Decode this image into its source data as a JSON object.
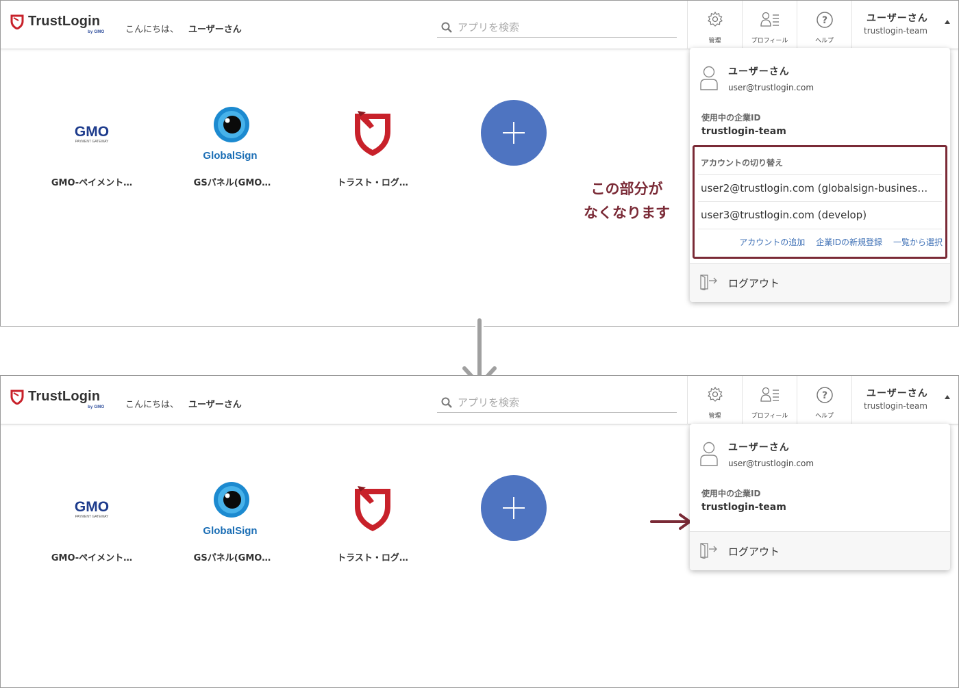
{
  "brand": {
    "name": "TrustLogin",
    "sub": "by GMO",
    "color": "#c8212a"
  },
  "header": {
    "greeting": "こんにちは、",
    "user_greet_name": "ユーザーさん",
    "search_placeholder": "アプリを検索",
    "nav": [
      {
        "icon": "gear-icon",
        "label": "管理"
      },
      {
        "icon": "profile-icon",
        "label": "プロフィール"
      },
      {
        "icon": "help-icon",
        "label": "ヘルプ"
      }
    ],
    "user_name": "ユーザーさん",
    "team": "trustlogin-team"
  },
  "apps": [
    {
      "icon": "gmo-logo",
      "name": "GMO-ペイメント…"
    },
    {
      "icon": "globalsign-logo",
      "name": "GSパネル(GMO…"
    },
    {
      "icon": "trustlogin-logo",
      "name": "トラスト・ログ…"
    }
  ],
  "logo_texts": {
    "gmo": "GMO",
    "gmo_sub": "PAYMENT GATEWAY",
    "globalsign": "GlobalSign"
  },
  "dropdown": {
    "user_name": "ユーザーさん",
    "email": "user@trustlogin.com",
    "company_label": "使用中の企業ID",
    "company_id": "trustlogin-team",
    "switch_title": "アカウントの切り替え",
    "accounts": [
      "user2@trustlogin.com (globalsign-busines…",
      "user3@trustlogin.com (develop)"
    ],
    "links": [
      "アカウントの追加",
      "企業IDの新規登録",
      "一覧から選択"
    ],
    "logout": "ログアウト"
  },
  "annotation": {
    "line1": "この部分が",
    "line2": "なくなります",
    "color": "#7a2a36"
  },
  "colors": {
    "add_button": "#4e74c1",
    "link": "#3d6fb5"
  }
}
